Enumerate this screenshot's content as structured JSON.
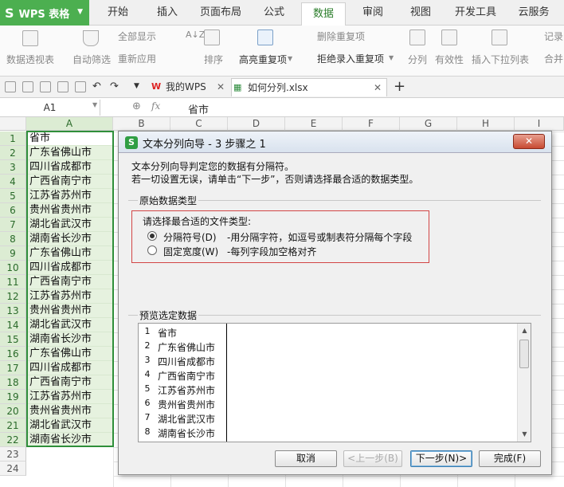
{
  "app": {
    "logo": "WPS 表格"
  },
  "menu_tabs": [
    "开始",
    "插入",
    "页面布局",
    "公式",
    "数据",
    "审阅",
    "视图",
    "开发工具",
    "云服务"
  ],
  "active_tab": "数据",
  "ribbon": {
    "pivot": "数据透视表",
    "autofilter": "自动筛选",
    "show_all": "全部显示",
    "reapply": "重新应用",
    "sort": "排序",
    "highlight_dup": "高亮重复项",
    "remove_dup": "删除重复项",
    "reject_dup": "拒绝录入重复项",
    "split": "分列",
    "validity": "有效性",
    "dropdown_list": "插入下拉列表",
    "record": "记录",
    "merge": "合并"
  },
  "quickbar": {
    "doc_tabs": [
      {
        "label": "我的WPS"
      },
      {
        "label": "如何分列.xlsx"
      }
    ]
  },
  "formula_bar": {
    "name_box": "A1",
    "fx": "fx",
    "content": "省市"
  },
  "columns": [
    "A",
    "B",
    "C",
    "D",
    "E",
    "F",
    "G",
    "H",
    "I"
  ],
  "rows": [
    {
      "n": "1",
      "v": "省市"
    },
    {
      "n": "2",
      "v": "广东省佛山市"
    },
    {
      "n": "3",
      "v": "四川省成都市"
    },
    {
      "n": "4",
      "v": "广西省南宁市"
    },
    {
      "n": "5",
      "v": "江苏省苏州市"
    },
    {
      "n": "6",
      "v": "贵州省贵州市"
    },
    {
      "n": "7",
      "v": "湖北省武汉市"
    },
    {
      "n": "8",
      "v": "湖南省长沙市"
    },
    {
      "n": "9",
      "v": "广东省佛山市"
    },
    {
      "n": "10",
      "v": "四川省成都市"
    },
    {
      "n": "11",
      "v": "广西省南宁市"
    },
    {
      "n": "12",
      "v": "江苏省苏州市"
    },
    {
      "n": "13",
      "v": "贵州省贵州市"
    },
    {
      "n": "14",
      "v": "湖北省武汉市"
    },
    {
      "n": "15",
      "v": "湖南省长沙市"
    },
    {
      "n": "16",
      "v": "广东省佛山市"
    },
    {
      "n": "17",
      "v": "四川省成都市"
    },
    {
      "n": "18",
      "v": "广西省南宁市"
    },
    {
      "n": "19",
      "v": "江苏省苏州市"
    },
    {
      "n": "20",
      "v": "贵州省贵州市"
    },
    {
      "n": "21",
      "v": "湖北省武汉市"
    },
    {
      "n": "22",
      "v": "湖南省长沙市"
    },
    {
      "n": "23",
      "v": ""
    },
    {
      "n": "24",
      "v": ""
    }
  ],
  "dialog": {
    "title": "文本分列向导 - 3 步骤之 1",
    "close": "✕",
    "intro1": "文本分列向导判定您的数据有分隔符。",
    "intro2": "若一切设置无误，请单击“下一步”，否则请选择最合适的数据类型。",
    "group_raw": "原始数据类型",
    "choose_type": "请选择最合适的文件类型:",
    "option1_label": "分隔符号(D)",
    "option1_desc": "-用分隔字符，如逗号或制表符分隔每个字段",
    "option2_label": "固定宽度(W)",
    "option2_desc": "-每列字段加空格对齐",
    "preview_label": "预览选定数据",
    "preview_rows": [
      {
        "n": "1",
        "v": "省市"
      },
      {
        "n": "2",
        "v": "广东省佛山市"
      },
      {
        "n": "3",
        "v": "四川省成都市"
      },
      {
        "n": "4",
        "v": "广西省南宁市"
      },
      {
        "n": "5",
        "v": "江苏省苏州市"
      },
      {
        "n": "6",
        "v": "贵州省贵州市"
      },
      {
        "n": "7",
        "v": "湖北省武汉市"
      },
      {
        "n": "8",
        "v": "湖南省长沙市"
      }
    ],
    "buttons": {
      "cancel": "取消",
      "back": "<上一步(B)",
      "next": "下一步(N)>",
      "finish": "完成(F)"
    }
  }
}
